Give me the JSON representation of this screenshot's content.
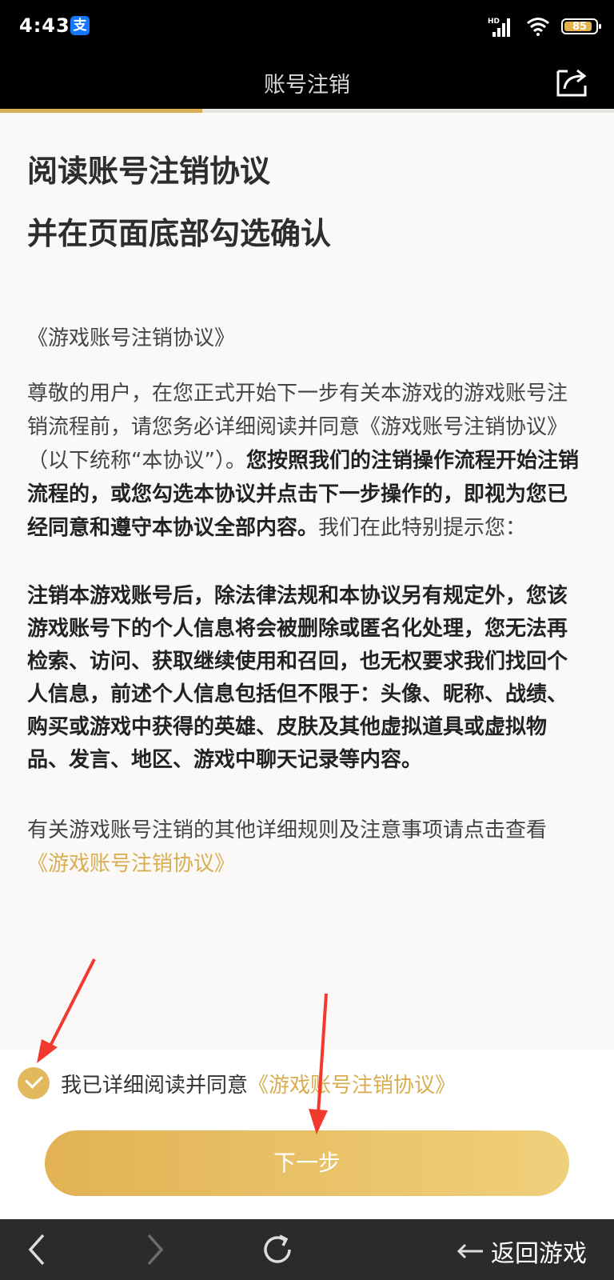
{
  "status_bar": {
    "time": "4:43",
    "app_badge": "支",
    "network_label": "HD",
    "battery": "85"
  },
  "nav": {
    "title": "账号注销",
    "progress_fraction": 0.33
  },
  "headline": {
    "line1": "阅读账号注销协议",
    "line2": "并在页面底部勾选确认"
  },
  "agreement": {
    "doc_title": "《游戏账号注销协议》",
    "intro_normal": "尊敬的用户，在您正式开始下一步有关本游戏的游戏账号注销流程前，请您务必详细阅读并同意《游戏账号注销协议》（以下统称“本协议”）。",
    "intro_bold": "您按照我们的注销操作流程开始注销流程的，或您勾选本协议并点击下一步操作的，即视为您已经同意和遵守本协议全部内容。",
    "intro_tail": "我们在此特别提示您：",
    "warning": "注销本游戏账号后，除法律法规和本协议另有规定外，您该游戏账号下的个人信息将会被删除或匿名化处理，您无法再检索、访问、获取继续使用和召回，也无权要求我们找回个人信息，前述个人信息包括但不限于：头像、昵称、战绩、购买或游戏中获得的英雄、皮肤及其他虚拟道具或虚拟物品、发言、地区、游戏中聊天记录等内容。",
    "more_text": "有关游戏账号注销的其他详细规则及注意事项请点击查看",
    "more_link": "《游戏账号注销协议》"
  },
  "consent": {
    "checked": true,
    "label": "我已详细阅读并同意",
    "link": "《游戏账号注销协议》"
  },
  "next_button": {
    "label": "下一步"
  },
  "bottom_bar": {
    "back_game_label": "返回游戏",
    "icons": [
      "back-icon",
      "forward-icon",
      "refresh-icon",
      "return-icon"
    ]
  },
  "colors": {
    "accent_gold": "#d9ad52",
    "annotation_red": "#f03a2e",
    "bar_black": "#000000",
    "bottom_bar": "#2b2b2b"
  }
}
